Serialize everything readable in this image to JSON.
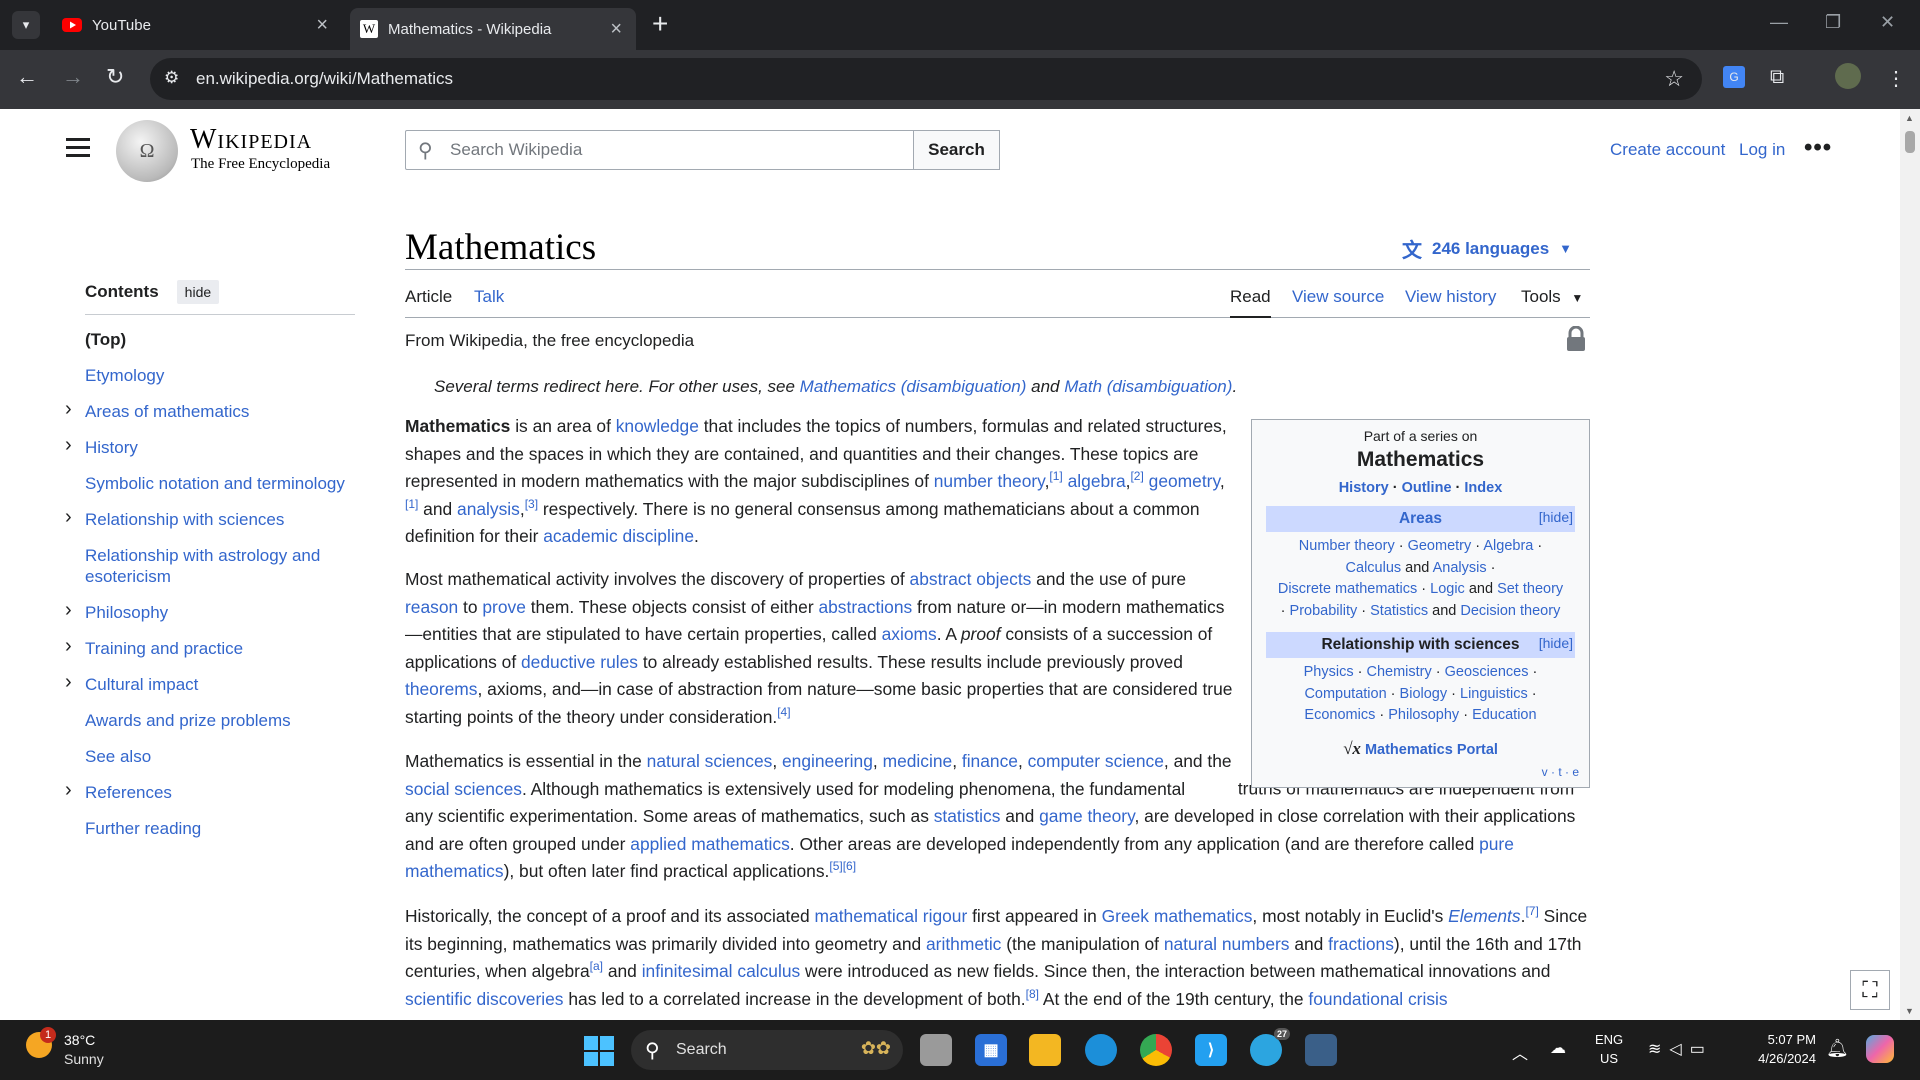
{
  "browser": {
    "tabs": [
      {
        "title": "YouTube",
        "icon": "youtube-icon"
      },
      {
        "title": "Mathematics - Wikipedia",
        "icon": "wikipedia-icon"
      }
    ],
    "url": "en.wikipedia.org/wiki/Mathematics"
  },
  "wiki": {
    "logo_word": "Wikipedia",
    "logo_tagline": "The Free Encyclopedia",
    "search_placeholder": "Search Wikipedia",
    "search_button": "Search",
    "create_account": "Create account",
    "log_in": "Log in"
  },
  "toc": {
    "title": "Contents",
    "hide": "hide",
    "items": [
      {
        "label": "(Top)",
        "expandable": false
      },
      {
        "label": "Etymology",
        "expandable": false
      },
      {
        "label": "Areas of mathematics",
        "expandable": true
      },
      {
        "label": "History",
        "expandable": true
      },
      {
        "label": "Symbolic notation and terminology",
        "expandable": false
      },
      {
        "label": "Relationship with sciences",
        "expandable": true
      },
      {
        "label": "Relationship with astrology and esotericism",
        "expandable": false
      },
      {
        "label": "Philosophy",
        "expandable": true
      },
      {
        "label": "Training and practice",
        "expandable": true
      },
      {
        "label": "Cultural impact",
        "expandable": true
      },
      {
        "label": "Awards and prize problems",
        "expandable": false
      },
      {
        "label": "See also",
        "expandable": false
      },
      {
        "label": "References",
        "expandable": true
      },
      {
        "label": "Further reading",
        "expandable": false
      }
    ]
  },
  "article": {
    "title": "Mathematics",
    "languages": "246 languages",
    "tabs": {
      "article": "Article",
      "talk": "Talk",
      "read": "Read",
      "view_source": "View source",
      "view_history": "View history",
      "tools": "Tools"
    },
    "from": "From Wikipedia, the free encyclopedia",
    "hatnote": {
      "pre": "Several terms redirect here. For other uses, see ",
      "link1": "Mathematics (disambiguation)",
      "mid": " and ",
      "link2": "Math (disambiguation)",
      "post": "."
    }
  },
  "infobox": {
    "pre": "Part of a series on",
    "title": "Mathematics",
    "links": [
      "History",
      "Outline",
      "Index"
    ],
    "areas_header": "Areas",
    "hide": "[hide]",
    "areas": [
      "Number theory",
      "Geometry",
      "Algebra",
      "Calculus",
      "Analysis",
      "Discrete mathematics",
      "Logic",
      "Set theory",
      "Probability",
      "Statistics",
      "Decision theory"
    ],
    "sciences_header": "Relationship with sciences",
    "sciences": [
      "Physics",
      "Chemistry",
      "Geosciences",
      "Computation",
      "Biology",
      "Linguistics",
      "Economics",
      "Philosophy",
      "Education"
    ],
    "portal": "Mathematics Portal",
    "vte": "v · t · e"
  },
  "taskbar": {
    "weather_temp": "38°C",
    "weather_desc": "Sunny",
    "weather_badge": "1",
    "search": "Search",
    "lang1": "ENG",
    "lang2": "US",
    "time": "5:07 PM",
    "date": "4/26/2024",
    "telegram_badge": "27"
  }
}
